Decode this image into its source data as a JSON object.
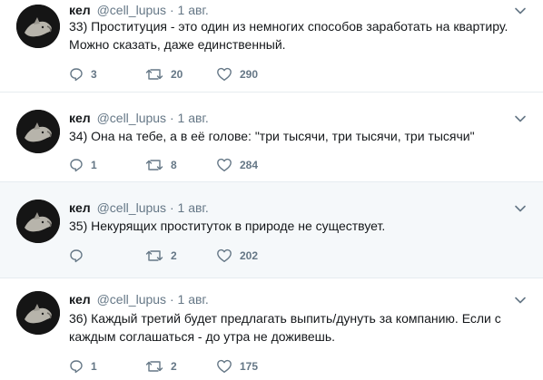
{
  "tweets": [
    {
      "name": "кел",
      "handle": "@cell_lupus",
      "separator": "·",
      "date": "1 авг.",
      "text_lines": [
        "33) Проституция - это один из немногих способов заработать на квартиру.",
        "Можно сказать, даже единственный."
      ],
      "replies": "3",
      "retweets": "20",
      "likes": "290"
    },
    {
      "name": "кел",
      "handle": "@cell_lupus",
      "separator": "·",
      "date": "1 авг.",
      "text_lines": [
        "34) Она на тебе, а в её голове: \"три тысячи, три тысячи, три тысячи\""
      ],
      "replies": "1",
      "retweets": "8",
      "likes": "284"
    },
    {
      "name": "кел",
      "handle": "@cell_lupus",
      "separator": "·",
      "date": "1 авг.",
      "text_lines": [
        "35) Некурящих проституток в природе не существует."
      ],
      "replies": "",
      "retweets": "2",
      "likes": "202"
    },
    {
      "name": "кел",
      "handle": "@cell_lupus",
      "separator": "·",
      "date": "1 авг.",
      "text_lines": [
        "36) Каждый третий будет предлагать выпить/дунуть за компанию. Если с",
        "каждым соглашаться - до утра не доживешь."
      ],
      "replies": "1",
      "retweets": "2",
      "likes": "175"
    }
  ],
  "icons": {
    "avatar": "wolf-avatar",
    "reply": "reply-icon",
    "retweet": "retweet-icon",
    "like": "heart-icon",
    "menu": "chevron-down-icon"
  },
  "colors": {
    "text": "#14171a",
    "muted": "#657786",
    "background": "#ffffff",
    "highlight_background": "#f5f8fa",
    "divider": "#e6ecf0"
  }
}
